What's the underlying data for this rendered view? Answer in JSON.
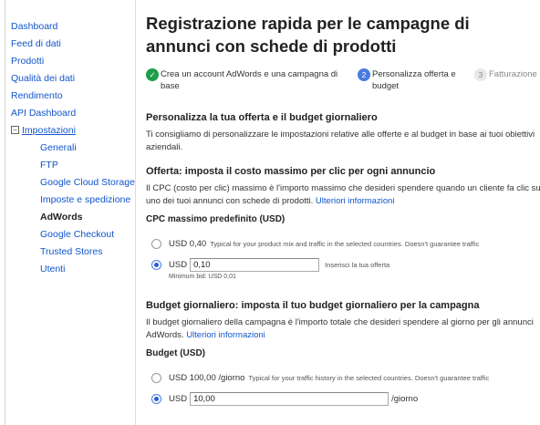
{
  "sidebar": {
    "items": [
      {
        "label": "Dashboard"
      },
      {
        "label": "Feed di dati"
      },
      {
        "label": "Prodotti"
      },
      {
        "label": "Qualità dei dati"
      },
      {
        "label": "Rendimento"
      },
      {
        "label": "API Dashboard"
      }
    ],
    "section": {
      "label": "Impostazioni",
      "toggle": "−"
    },
    "sub_items": [
      {
        "label": "Generali"
      },
      {
        "label": "FTP"
      },
      {
        "label": "Google Cloud Storage"
      },
      {
        "label": "Imposte e spedizione"
      },
      {
        "label": "AdWords"
      },
      {
        "label": "Google Checkout"
      },
      {
        "label": "Trusted Stores"
      },
      {
        "label": "Utenti"
      }
    ]
  },
  "main": {
    "title": "Registrazione rapida per le campagne di annunci con schede di prodotti",
    "steps": [
      {
        "number": "✓",
        "label": "Crea un account AdWords e una campagna di base"
      },
      {
        "number": "2",
        "label": "Personalizza offerta e budget"
      },
      {
        "number": "3",
        "label": "Fatturazione"
      }
    ],
    "personalize": {
      "title": "Personalizza la tua offerta e il budget giornaliero",
      "text": "Ti consigliamo di personalizzare le impostazioni relative alle offerte e al budget in base ai tuoi obiettivi aziendali."
    },
    "offer": {
      "title": "Offerta: imposta il costo massimo per clic per ogni annuncio",
      "text": "Il CPC (costo per clic) massimo è l'importo massimo che desideri spendere quando un cliente fa clic su uno dei tuoi annunci con schede di prodotti.",
      "link": "Ulteriori informazioni",
      "subhead": "CPC massimo predefinito (USD)",
      "option1_label": "USD 0,40",
      "option1_hint": "Typical for your product mix and traffic in the selected countries. Doesn't guarantee traffic",
      "option2_currency": "USD",
      "option2_value": "0,10",
      "option2_after": "Inserisci la tua offerta",
      "min_bid": "Minimum bid: USD 0,01"
    },
    "budget": {
      "title": "Budget giornaliero: imposta il tuo budget giornaliero per la campagna",
      "text": "Il budget giornaliero della campagna è l'importo totale che desideri spendere al giorno per gli annunci AdWords.",
      "link": "Ulteriori informazioni",
      "subhead": "Budget (USD)",
      "option1_label": "USD 100,00 /giorno",
      "option1_hint": "Typical for your traffic history in the selected countries. Doesn't guarantee traffic",
      "option2_currency": "USD",
      "option2_value": "10,00",
      "option2_after": "/giorno"
    }
  }
}
